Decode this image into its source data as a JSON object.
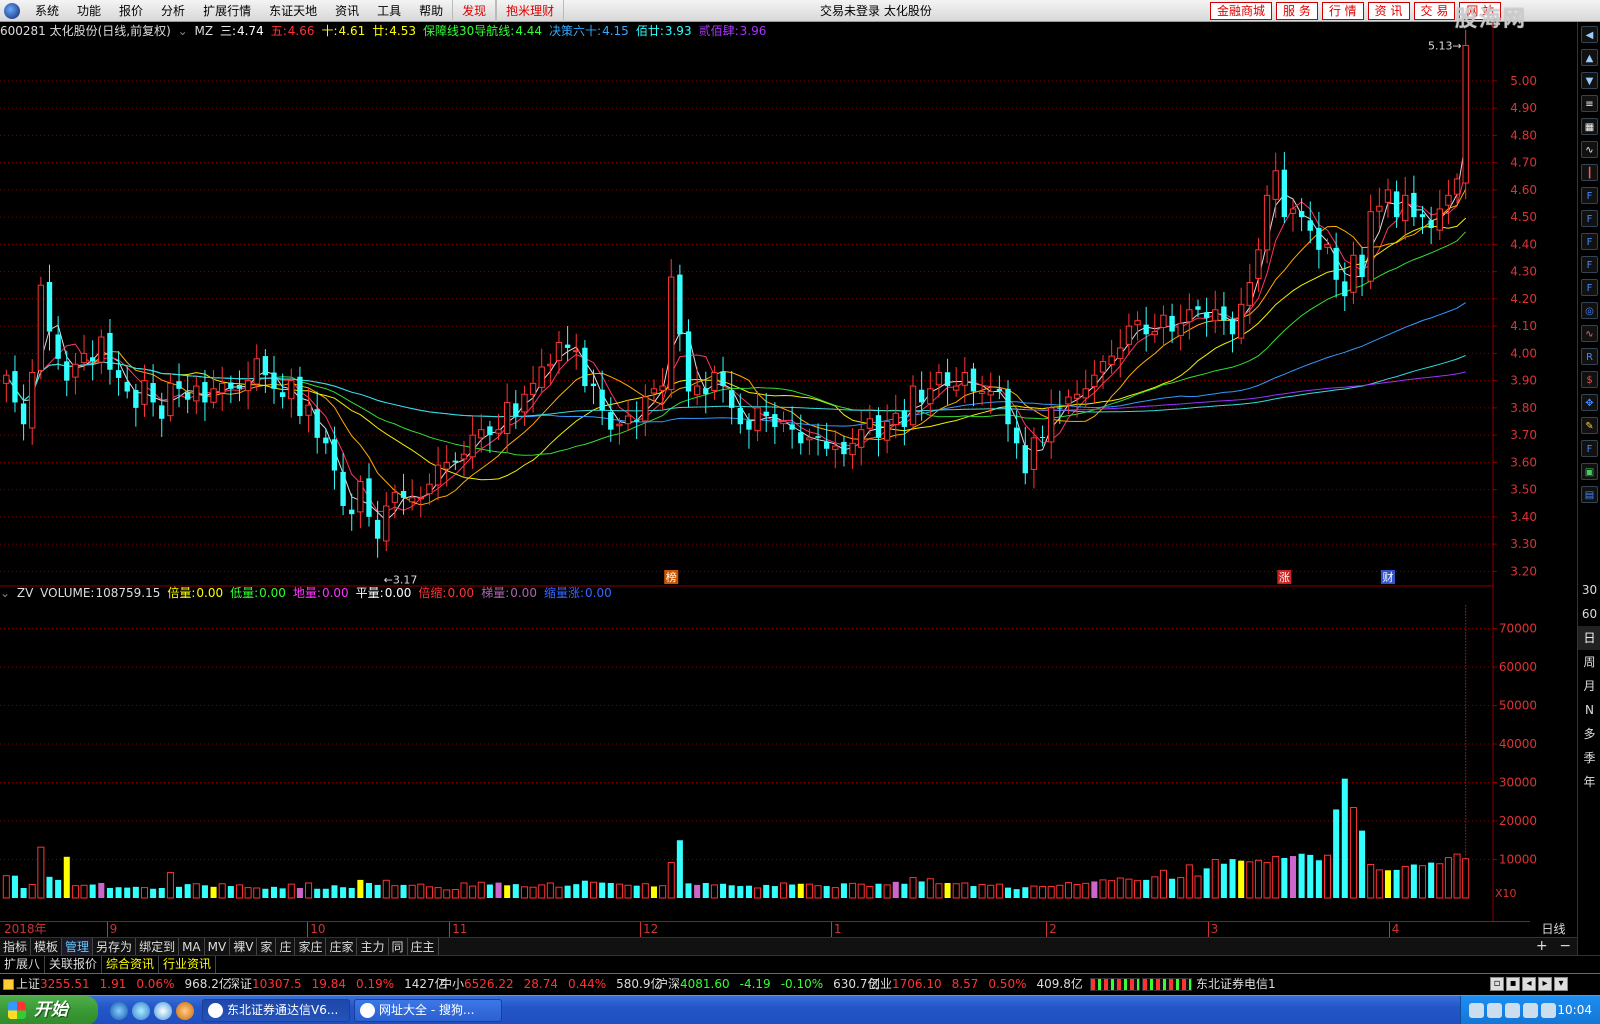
{
  "menu": {
    "items": [
      "系统",
      "功能",
      "报价",
      "分析",
      "扩展行情",
      "东证天地",
      "资讯",
      "工具",
      "帮助"
    ],
    "red_items": [
      "发现",
      "抱米理财"
    ],
    "center_title": "交易未登录  太化股份",
    "right_buttons": [
      "金融商城",
      "服 务",
      "行 情",
      "资 讯",
      "交 易",
      "网 站"
    ],
    "brand": "股海网"
  },
  "price_chart": {
    "header": {
      "code_name": "600281 太化股份(日线,前复权)",
      "indicator": "MZ",
      "items": [
        {
          "label": "三:",
          "value": "4.74",
          "color": "#ffffff"
        },
        {
          "label": "五:",
          "value": "4.66",
          "color": "#ff3333"
        },
        {
          "label": "十:",
          "value": "4.61",
          "color": "#ffff00"
        },
        {
          "label": "廿:",
          "value": "4.53",
          "color": "#ffff00"
        },
        {
          "label": "保障线30导航线:",
          "value": "4.44",
          "color": "#33ff33"
        },
        {
          "label": "决策六十:",
          "value": "4.15",
          "color": "#33aaff"
        },
        {
          "label": "佰廿:",
          "value": "3.93",
          "color": "#33ffff"
        },
        {
          "label": "贰佰肆:",
          "value": "3.96",
          "color": "#aa33ff"
        }
      ]
    },
    "y_ticks": [
      "5.00",
      "4.90",
      "4.80",
      "4.70",
      "4.60",
      "4.50",
      "4.40",
      "4.30",
      "4.20",
      "4.10",
      "4.00",
      "3.90",
      "3.80",
      "3.70",
      "3.60",
      "3.50",
      "3.40",
      "3.30",
      "3.20"
    ],
    "annotations": {
      "low": "←3.17",
      "high": "5.13→",
      "markers": [
        {
          "text": "榜",
          "color": "#cc5500"
        },
        {
          "text": "涨",
          "color": "#cc2222"
        },
        {
          "text": "财",
          "color": "#3355cc"
        }
      ]
    }
  },
  "volume_chart": {
    "header": {
      "indicator": "ZV",
      "items": [
        {
          "label": "VOLUME:",
          "value": "108759.15",
          "color": "#dddddd"
        },
        {
          "label": "倍量:",
          "value": "0.00",
          "color": "#ffff00"
        },
        {
          "label": "低量:",
          "value": "0.00",
          "color": "#33ff33"
        },
        {
          "label": "地量:",
          "value": "0.00",
          "color": "#ff33ff"
        },
        {
          "label": "平量:",
          "value": "0.00",
          "color": "#ffffff"
        },
        {
          "label": "倍缩:",
          "value": "0.00",
          "color": "#ff3333"
        },
        {
          "label": "梯量:",
          "value": "0.00",
          "color": "#aa66aa"
        },
        {
          "label": "缩量涨:",
          "value": "0.00",
          "color": "#3366ff"
        }
      ]
    },
    "y_ticks": [
      "70000",
      "60000",
      "50000",
      "40000",
      "30000",
      "20000",
      "10000"
    ],
    "unit": "X10"
  },
  "date_axis": {
    "labels": [
      "2018年",
      "9",
      "10",
      "11",
      "12",
      "1",
      "2",
      "3",
      "4"
    ],
    "period": "日线"
  },
  "right_toolbar": {
    "periods": [
      "30",
      "60",
      "日",
      "周",
      "月",
      "N",
      "多",
      "季",
      "年"
    ],
    "active": "日"
  },
  "tabs_row1": [
    "指标",
    "模板",
    "管理",
    "另存为",
    "绑定到",
    "MA",
    "MV",
    "裸V",
    "家",
    "庄",
    "家庄",
    "庄家",
    "主力",
    "同",
    "庄主"
  ],
  "tabs_row1_selected": "管理",
  "tabs_row2": [
    "扩展八",
    "关联报价",
    "综合资讯",
    "行业资讯"
  ],
  "tabs_row2_selected": [
    "综合资讯",
    "行业资讯"
  ],
  "status": {
    "sh": {
      "name": "上证",
      "value": "3255.51",
      "chg": "1.91",
      "pct": "0.06%",
      "amt": "968.2亿"
    },
    "sz": {
      "name": "深证",
      "value": "10307.5",
      "chg": "19.84",
      "pct": "0.19%",
      "amt": "1427亿"
    },
    "zx": {
      "name": "中小",
      "value": "6526.22",
      "chg": "28.74",
      "pct": "0.44%",
      "amt": "580.9亿"
    },
    "hs": {
      "name": "沪深",
      "value": "4081.60",
      "chg": "-4.19",
      "pct": "-0.10%",
      "amt": "630.7亿"
    },
    "cy": {
      "name": "创业",
      "value": "1706.10",
      "chg": "8.57",
      "pct": "0.50%",
      "amt": "409.8亿"
    },
    "broker": "东北证券电信1"
  },
  "taskbar": {
    "start": "开始",
    "windows": [
      "东北证券通达信V6...",
      "网址大全 - 搜狗..."
    ],
    "clock": "10:04"
  },
  "colors": {
    "up": "#ff3333",
    "down": "#33ffff",
    "grid": "#880000"
  },
  "chart_data": {
    "type": "candlestick",
    "title": "600281 太化股份(日线,前复权)",
    "ylim": [
      3.15,
      5.15
    ],
    "volume_ylim": [
      0,
      80000
    ],
    "x_periods": [
      "2018年",
      "9",
      "10",
      "11",
      "12",
      "1",
      "2",
      "3",
      "4"
    ],
    "close_prices": [
      3.92,
      3.82,
      3.74,
      3.93,
      4.25,
      4.08,
      3.98,
      3.9,
      3.96,
      4.0,
      3.97,
      4.06,
      3.94,
      3.91,
      3.86,
      3.8,
      3.9,
      3.82,
      3.76,
      3.89,
      3.87,
      3.83,
      3.88,
      3.82,
      3.87,
      3.89,
      3.87,
      3.87,
      3.9,
      3.98,
      3.92,
      3.87,
      3.84,
      3.9,
      3.77,
      3.81,
      3.69,
      3.67,
      3.57,
      3.44,
      3.41,
      3.53,
      3.4,
      3.32,
      3.44,
      3.49,
      3.47,
      3.47,
      3.47,
      3.52,
      3.59,
      3.6,
      3.6,
      3.63,
      3.7,
      3.72,
      3.7,
      3.72,
      3.82,
      3.77,
      3.85,
      3.89,
      3.95,
      3.96,
      4.04,
      4.02,
      4.01,
      3.88,
      3.88,
      3.79,
      3.72,
      3.74,
      3.77,
      3.75,
      3.84,
      3.87,
      3.88,
      4.28,
      4.07,
      3.86,
      3.88,
      3.85,
      3.93,
      3.88,
      3.8,
      3.74,
      3.72,
      3.8,
      3.77,
      3.73,
      3.75,
      3.72,
      3.67,
      3.69,
      3.69,
      3.65,
      3.66,
      3.63,
      3.67,
      3.72,
      3.76,
      3.69,
      3.75,
      3.78,
      3.73,
      3.88,
      3.82,
      3.87,
      3.93,
      3.88,
      3.88,
      3.93,
      3.86,
      3.86,
      3.86,
      3.86,
      3.74,
      3.67,
      3.56,
      3.69,
      3.69,
      3.8,
      3.8,
      3.84,
      3.85,
      3.87,
      3.92,
      3.97,
      3.99,
      4.02,
      4.1,
      4.12,
      4.07,
      4.08,
      4.14,
      4.08,
      4.11,
      4.16,
      4.16,
      4.13,
      4.16,
      4.12,
      4.07,
      4.18,
      4.26,
      4.38,
      4.58,
      4.67,
      4.5,
      4.53,
      4.5,
      4.45,
      4.38,
      4.4,
      4.27,
      4.21,
      4.36,
      4.28,
      4.52,
      4.54,
      4.6,
      4.5,
      4.58,
      4.5,
      4.5,
      4.46,
      4.53,
      4.58,
      4.64,
      5.13
    ],
    "volume": [
      5800,
      5800,
      2600,
      3500,
      13200,
      5500,
      4700,
      10700,
      3200,
      3300,
      3500,
      3900,
      2600,
      2800,
      2700,
      2900,
      2700,
      2400,
      2600,
      6600,
      2900,
      3600,
      3700,
      3300,
      2900,
      3700,
      3100,
      3400,
      2700,
      2600,
      2400,
      2900,
      2500,
      3600,
      2600,
      3900,
      2400,
      2400,
      3300,
      2800,
      2600,
      4700,
      3900,
      3400,
      4600,
      3200,
      3400,
      3300,
      3600,
      2900,
      2700,
      2100,
      2200,
      3900,
      3100,
      4100,
      3500,
      4000,
      3300,
      3600,
      2900,
      2800,
      3400,
      3900,
      2800,
      3200,
      3600,
      4500,
      4100,
      4000,
      3900,
      3600,
      3300,
      3200,
      3700,
      3000,
      3200,
      9200,
      15000,
      3800,
      3400,
      3900,
      3400,
      3700,
      3300,
      3100,
      3200,
      2600,
      3400,
      3100,
      3900,
      3500,
      3700,
      3600,
      3200,
      3100,
      2700,
      3800,
      3800,
      3600,
      3000,
      3700,
      3400,
      4200,
      3700,
      5300,
      4300,
      5000,
      3700,
      3900,
      3700,
      3900,
      3100,
      3500,
      3300,
      3600,
      2700,
      2300,
      2800,
      3100,
      3000,
      3000,
      3300,
      4000,
      3500,
      3800,
      4300,
      4700,
      4500,
      5200,
      4900,
      4500,
      4700,
      5500,
      7200,
      5000,
      5300,
      8600,
      5700,
      7700,
      10000,
      8900,
      10100,
      9700,
      9400,
      9800,
      9200,
      10800,
      10400,
      10900,
      11500,
      11200,
      9800,
      11100,
      23000,
      31000,
      23500,
      17500,
      8700,
      7300,
      7200,
      7300,
      8200,
      8700,
      8400,
      9200,
      8900,
      10500,
      11400,
      10200,
      9600,
      8700,
      5100,
      9200,
      5000,
      9200,
      10900
    ]
  }
}
